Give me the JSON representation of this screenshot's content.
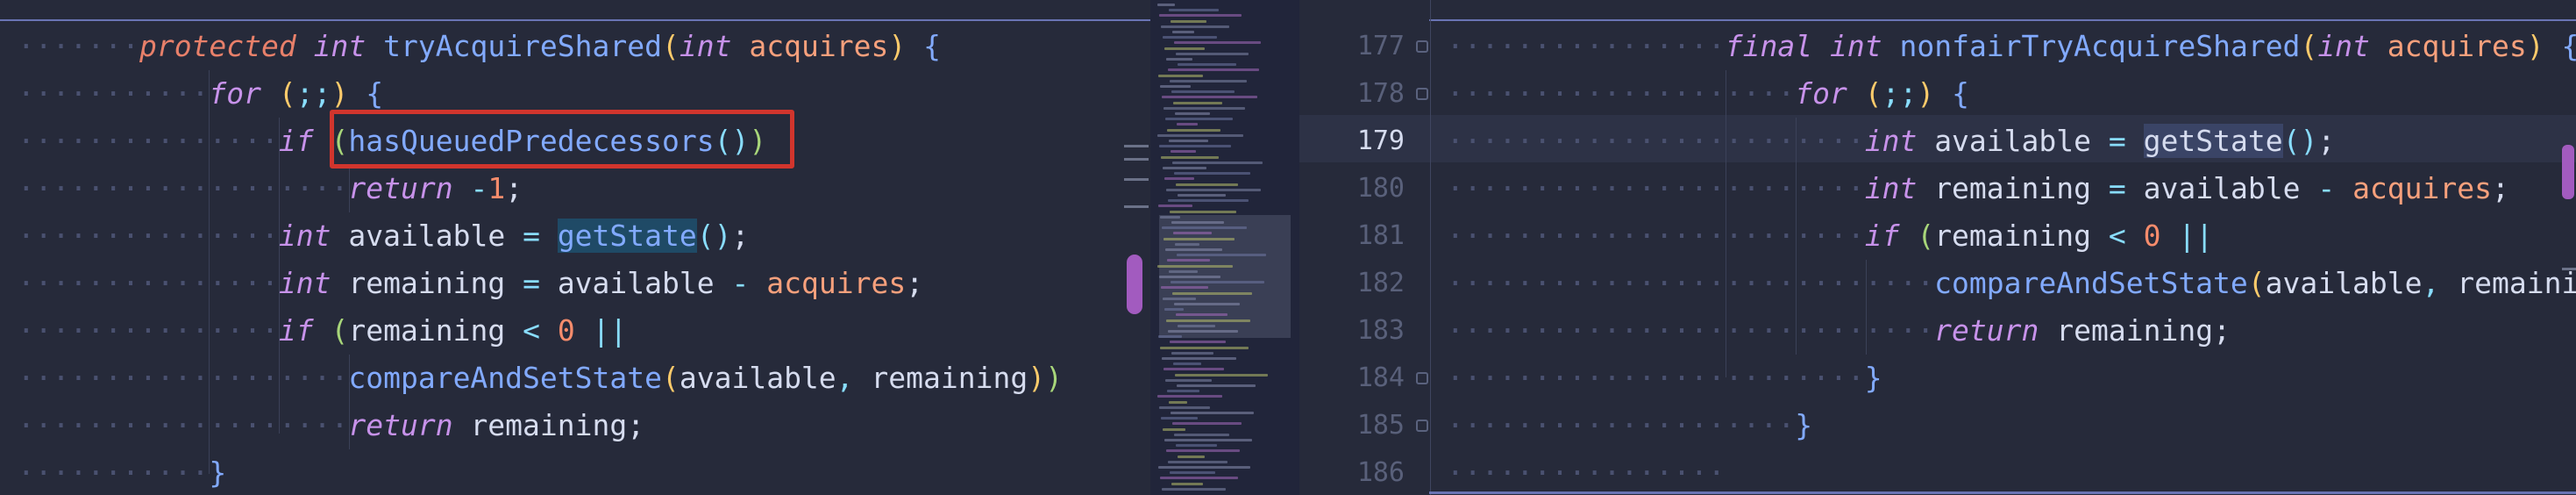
{
  "left_editor": {
    "lines": [
      [
        {
          "t": "protected ",
          "c": "kw-prot"
        },
        {
          "t": "int ",
          "c": "kw"
        },
        {
          "t": "tryAcquireShared",
          "c": "fn"
        },
        {
          "t": "(",
          "c": "paren-y"
        },
        {
          "t": "int ",
          "c": "kw"
        },
        {
          "t": "acquires",
          "c": "param"
        },
        {
          "t": ") ",
          "c": "paren-y"
        },
        {
          "t": "{",
          "c": "brace-b"
        }
      ],
      [
        {
          "t": "for ",
          "c": "kw"
        },
        {
          "t": "(",
          "c": "paren-y"
        },
        {
          "t": ";;",
          "c": "punc"
        },
        {
          "t": ") ",
          "c": "paren-y"
        },
        {
          "t": "{",
          "c": "brace-b"
        }
      ],
      [
        {
          "t": "if ",
          "c": "kw"
        },
        {
          "t": "(",
          "c": "paren-g"
        },
        {
          "t": "hasQueuedPredecessors",
          "c": "fn"
        },
        {
          "t": "()",
          "c": "punc"
        },
        {
          "t": ")",
          "c": "paren-g"
        }
      ],
      [
        {
          "t": "return ",
          "c": "kw"
        },
        {
          "t": "-",
          "c": "op"
        },
        {
          "t": "1",
          "c": "num"
        },
        {
          "t": ";",
          "c": "plain"
        }
      ],
      [
        {
          "t": "int ",
          "c": "kw"
        },
        {
          "t": "available ",
          "c": "plain"
        },
        {
          "t": "= ",
          "c": "op"
        },
        {
          "t": "getState",
          "c": "fn word-hl"
        },
        {
          "t": "()",
          "c": "punc"
        },
        {
          "t": ";",
          "c": "plain"
        }
      ],
      [
        {
          "t": "int ",
          "c": "kw"
        },
        {
          "t": "remaining ",
          "c": "plain"
        },
        {
          "t": "= ",
          "c": "op"
        },
        {
          "t": "available ",
          "c": "plain"
        },
        {
          "t": "- ",
          "c": "op"
        },
        {
          "t": "acquires",
          "c": "param"
        },
        {
          "t": ";",
          "c": "plain"
        }
      ],
      [
        {
          "t": "if ",
          "c": "kw"
        },
        {
          "t": "(",
          "c": "paren-g"
        },
        {
          "t": "remaining ",
          "c": "plain"
        },
        {
          "t": "< ",
          "c": "op"
        },
        {
          "t": "0 ",
          "c": "num"
        },
        {
          "t": "||",
          "c": "op"
        }
      ],
      [
        {
          "t": "compareAndSetState",
          "c": "fn"
        },
        {
          "t": "(",
          "c": "paren-y"
        },
        {
          "t": "available",
          "c": "plain"
        },
        {
          "t": ", ",
          "c": "punc"
        },
        {
          "t": "remaining",
          "c": "plain"
        },
        {
          "t": ")",
          "c": "paren-y"
        },
        {
          "t": ")",
          "c": "paren-g"
        }
      ],
      [
        {
          "t": "return ",
          "c": "kw"
        },
        {
          "t": "remaining",
          "c": "plain"
        },
        {
          "t": ";",
          "c": "plain"
        }
      ],
      [
        {
          "t": "}",
          "c": "brace-b"
        }
      ]
    ]
  },
  "right_editor": {
    "line_numbers": [
      "177",
      "178",
      "179",
      "180",
      "181",
      "182",
      "183",
      "184",
      "185",
      "186"
    ],
    "current_line": "179",
    "lines": [
      [
        {
          "t": "final ",
          "c": "kw"
        },
        {
          "t": "int ",
          "c": "kw"
        },
        {
          "t": "nonfairTryAcquireShared",
          "c": "fn"
        },
        {
          "t": "(",
          "c": "paren-y"
        },
        {
          "t": "int ",
          "c": "kw"
        },
        {
          "t": "acquires",
          "c": "param"
        },
        {
          "t": ") ",
          "c": "paren-y"
        },
        {
          "t": "{",
          "c": "brace-b"
        }
      ],
      [
        {
          "t": "for ",
          "c": "kw"
        },
        {
          "t": "(",
          "c": "paren-y"
        },
        {
          "t": ";;",
          "c": "punc"
        },
        {
          "t": ") ",
          "c": "paren-y"
        },
        {
          "t": "{",
          "c": "brace-b"
        }
      ],
      [
        {
          "t": "int ",
          "c": "kw"
        },
        {
          "t": "available ",
          "c": "plain"
        },
        {
          "t": "= ",
          "c": "op"
        },
        {
          "t": "getState",
          "c": "plain word-hl2"
        },
        {
          "t": "()",
          "c": "punc"
        },
        {
          "t": ";",
          "c": "plain"
        }
      ],
      [
        {
          "t": "int ",
          "c": "kw"
        },
        {
          "t": "remaining ",
          "c": "plain"
        },
        {
          "t": "= ",
          "c": "op"
        },
        {
          "t": "available ",
          "c": "plain"
        },
        {
          "t": "- ",
          "c": "op"
        },
        {
          "t": "acquires",
          "c": "param"
        },
        {
          "t": ";",
          "c": "plain"
        }
      ],
      [
        {
          "t": "if ",
          "c": "kw"
        },
        {
          "t": "(",
          "c": "paren-g"
        },
        {
          "t": "remaining ",
          "c": "plain"
        },
        {
          "t": "< ",
          "c": "op"
        },
        {
          "t": "0 ",
          "c": "num"
        },
        {
          "t": "||",
          "c": "op"
        }
      ],
      [
        {
          "t": "compareAndSetState",
          "c": "fn"
        },
        {
          "t": "(",
          "c": "paren-y"
        },
        {
          "t": "available",
          "c": "plain"
        },
        {
          "t": ", ",
          "c": "punc"
        },
        {
          "t": "remaining",
          "c": "plain"
        },
        {
          "t": ")",
          "c": "paren-y"
        },
        {
          "t": ")",
          "c": "paren-g"
        }
      ],
      [
        {
          "t": "return ",
          "c": "kw"
        },
        {
          "t": "remaining",
          "c": "plain"
        },
        {
          "t": ";",
          "c": "plain"
        }
      ],
      [
        {
          "t": "}",
          "c": "brace-b"
        }
      ],
      [
        {
          "t": "}",
          "c": "brace-b"
        }
      ],
      []
    ]
  },
  "colors": {
    "background": "#262a3a",
    "highlight_box": "#d1352d",
    "accent": "#6a74b4",
    "scrollbar_thumb": "#a25bbf"
  },
  "icons": [
    "fold-marker-icon"
  ]
}
